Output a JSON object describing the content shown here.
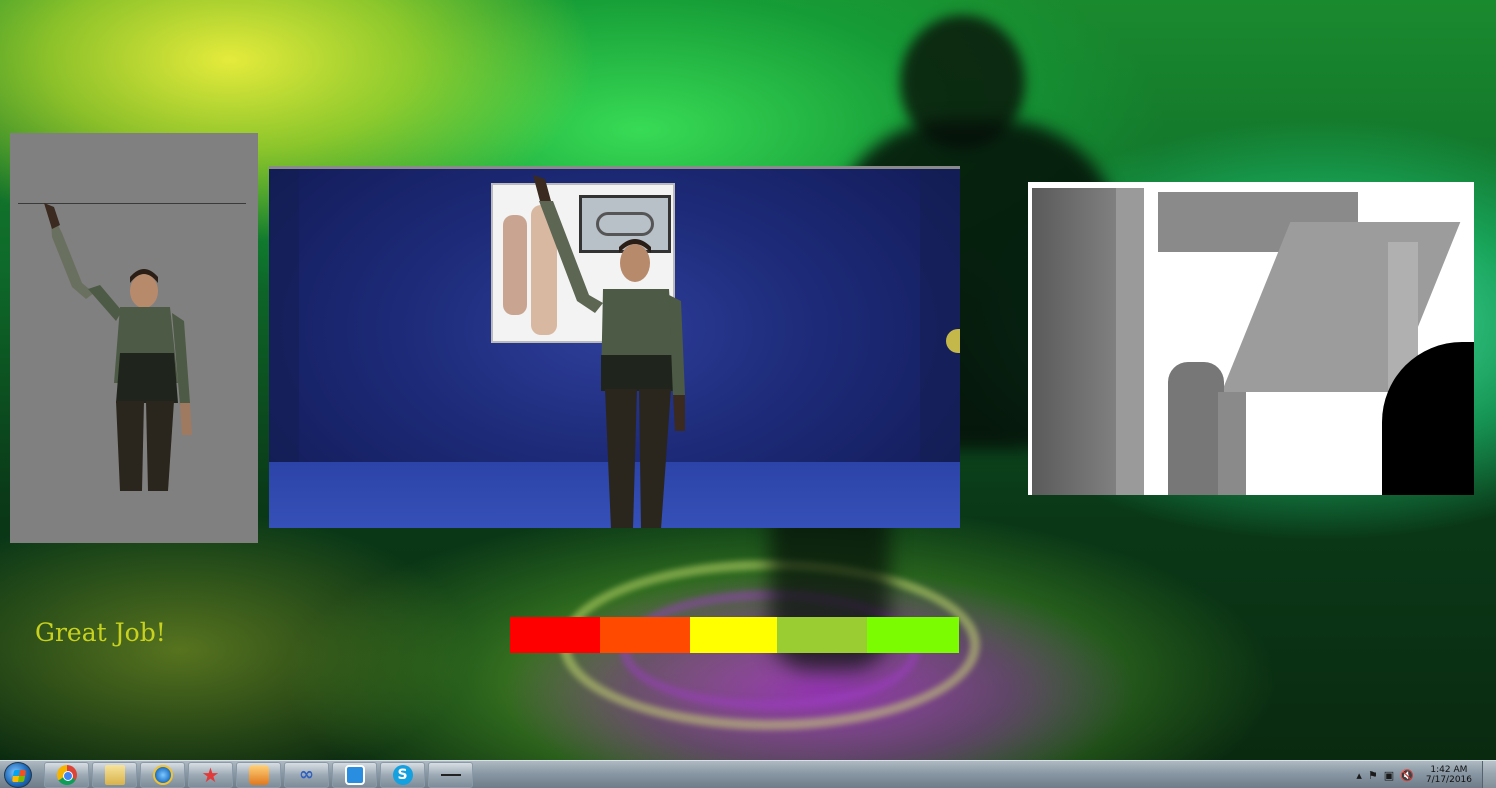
{
  "feedback": {
    "message": "Great Job!",
    "message_color": "#c8d21e"
  },
  "score_meter": {
    "segments": [
      {
        "color": "#ff0000",
        "width_units": 90
      },
      {
        "color": "#ff4a00",
        "width_units": 90
      },
      {
        "color": "#ffff00",
        "width_units": 87
      },
      {
        "color": "#9acd32",
        "width_units": 90
      },
      {
        "color": "#7cfc00",
        "width_units": 92
      }
    ]
  },
  "taskbar": {
    "apps": [
      {
        "name": "chrome",
        "icon": "chrome-icon"
      },
      {
        "name": "file-explorer",
        "icon": "folder-icon"
      },
      {
        "name": "internet-explorer",
        "icon": "ie-icon"
      },
      {
        "name": "star-app",
        "icon": "star-icon",
        "glyph": "★"
      },
      {
        "name": "media-player",
        "icon": "media-player-icon"
      },
      {
        "name": "infinity-app",
        "icon": "infinity-icon",
        "glyph": "∞"
      },
      {
        "name": "kinect-studio",
        "icon": "kinect-icon"
      },
      {
        "name": "skype",
        "icon": "skype-icon",
        "glyph": "S"
      },
      {
        "name": "window-app",
        "icon": "window-icon"
      }
    ],
    "clock_time": "1:42 AM",
    "clock_date": "7/17/2016"
  }
}
